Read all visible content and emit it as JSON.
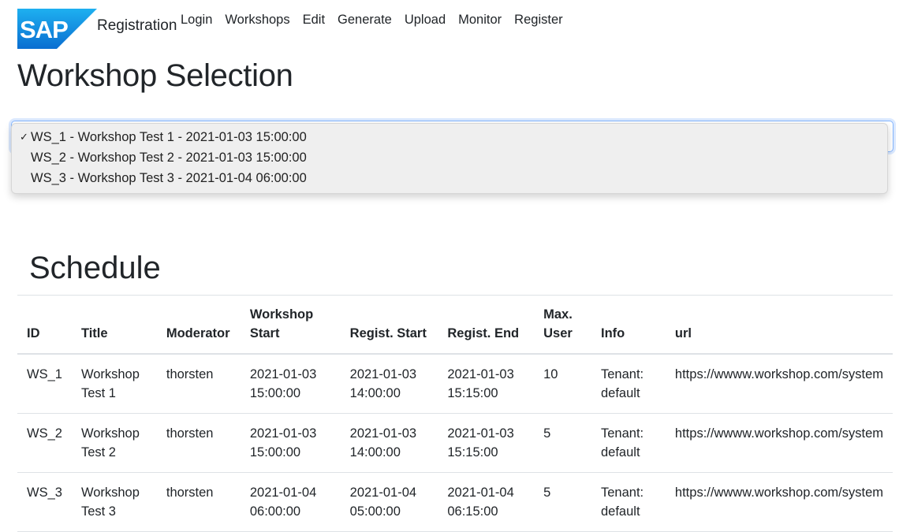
{
  "brand": {
    "logo_text": "SAP",
    "title": "Registration"
  },
  "nav": {
    "items": [
      "Login",
      "Workshops",
      "Edit",
      "Generate",
      "Upload",
      "Monitor",
      "Register"
    ]
  },
  "page_title": "Workshop Selection",
  "workshop_select": {
    "selected_index": 0,
    "options": [
      "WS_1 - Workshop Test 1 - 2021-01-03 15:00:00",
      "WS_2 - Workshop Test 2 - 2021-01-03 15:00:00",
      "WS_3 - Workshop Test 3 - 2021-01-04 06:00:00"
    ],
    "check_glyph": "✓"
  },
  "schedule": {
    "title": "Schedule",
    "columns": [
      "ID",
      "Title",
      "Moderator",
      "Workshop Start",
      "Regist. Start",
      "Regist. End",
      "Max. User",
      "Info",
      "url"
    ],
    "rows": [
      [
        "WS_1",
        "Workshop Test 1",
        "thorsten",
        "2021-01-03 15:00:00",
        "2021-01-03 14:00:00",
        "2021-01-03 15:15:00",
        "10",
        "Tenant: default",
        "https://wwww.workshop.com/system"
      ],
      [
        "WS_2",
        "Workshop Test 2",
        "thorsten",
        "2021-01-03 15:00:00",
        "2021-01-03 14:00:00",
        "2021-01-03 15:15:00",
        "5",
        "Tenant: default",
        "https://wwww.workshop.com/system"
      ],
      [
        "WS_3",
        "Workshop Test 3",
        "thorsten",
        "2021-01-04 06:00:00",
        "2021-01-04 05:00:00",
        "2021-01-04 06:15:00",
        "5",
        "Tenant: default",
        "https://wwww.workshop.com/system"
      ]
    ]
  },
  "colors": {
    "sap_blue_top": "#1eb0f0",
    "sap_blue_bottom": "#0a6ed1",
    "text": "#212529",
    "border": "#dee2e6"
  }
}
